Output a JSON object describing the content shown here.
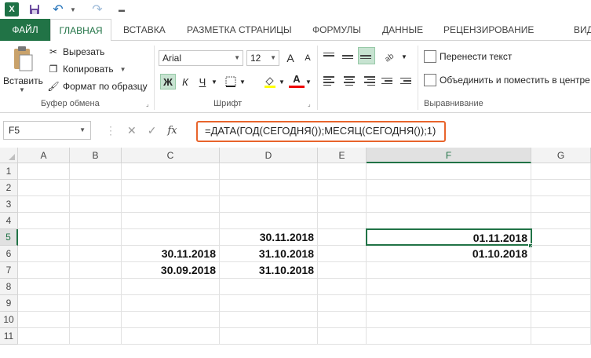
{
  "app": {
    "logo_letter": "X"
  },
  "tabs": {
    "file": "ФАЙЛ",
    "home": "ГЛАВНАЯ",
    "insert": "ВСТАВКА",
    "page_layout": "РАЗМЕТКА СТРАНИЦЫ",
    "formulas": "ФОРМУЛЫ",
    "data": "ДАННЫЕ",
    "review": "РЕЦЕНЗИРОВАНИЕ",
    "view": "ВИД"
  },
  "ribbon": {
    "clipboard": {
      "paste": "Вставить",
      "cut": "Вырезать",
      "copy": "Копировать",
      "format_painter": "Формат по образцу",
      "group_label": "Буфер обмена"
    },
    "font": {
      "font_name": "Arial",
      "font_size": "12",
      "bold": "Ж",
      "italic": "К",
      "underline": "Ч",
      "grow": "A",
      "shrink": "A",
      "font_color": "A",
      "group_label": "Шрифт"
    },
    "alignment": {
      "wrap_text": "Перенести текст",
      "merge_center": "Объединить и поместить в центре",
      "group_label": "Выравнивание"
    }
  },
  "formula_bar": {
    "name_box": "F5",
    "cancel": "✕",
    "enter": "✓",
    "fx": "fx",
    "formula": "=ДАТА(ГОД(СЕГОДНЯ());МЕСЯЦ(СЕГОДНЯ());1)"
  },
  "sheet": {
    "columns": [
      "A",
      "B",
      "C",
      "D",
      "E",
      "F",
      "G"
    ],
    "rows": [
      "1",
      "2",
      "3",
      "4",
      "5",
      "6",
      "7",
      "8",
      "9",
      "10",
      "11"
    ],
    "active_cell": "F5",
    "cells": {
      "D5": "30.11.2018",
      "F5": "01.11.2018",
      "C6": "30.11.2018",
      "D6": "31.10.2018",
      "F6": "01.10.2018",
      "C7": "30.09.2018",
      "D7": "31.10.2018"
    }
  },
  "colors": {
    "accent": "#217346",
    "formula_highlight": "#e8642c"
  }
}
